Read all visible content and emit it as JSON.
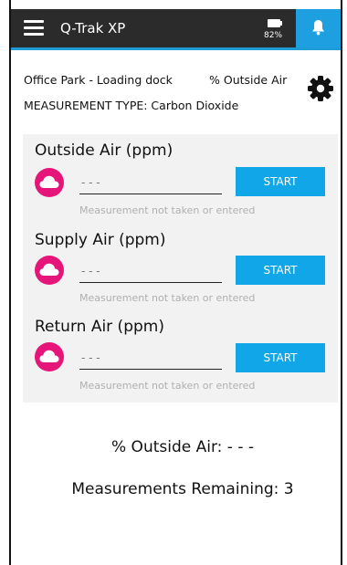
{
  "app": {
    "title": "Q-Trak XP",
    "battery": "82%"
  },
  "header": {
    "location": "Office Park - Loading dock",
    "calc_type": "% Outside Air",
    "measurement_type": "MEASUREMENT TYPE: Carbon Dioxide"
  },
  "sections": [
    {
      "title": "Outside Air (ppm)",
      "value": "",
      "placeholder": "- - -",
      "button": "START",
      "hint": "Measurement not taken or entered"
    },
    {
      "title": "Supply Air (ppm)",
      "value": "",
      "placeholder": "- - -",
      "button": "START",
      "hint": "Measurement not taken or entered"
    },
    {
      "title": "Return Air (ppm)",
      "value": "",
      "placeholder": "- - -",
      "button": "START",
      "hint": "Measurement not taken or entered"
    }
  ],
  "results": {
    "pct_outside_air": "% Outside Air: - - -",
    "remaining": "Measurements Remaining: 3"
  },
  "colors": {
    "topbar": "#2b2b2b",
    "accent": "#1e9fe0",
    "start_button": "#11a6e8",
    "cloud_button": "#e5157a",
    "card": "#f2f2f2"
  },
  "icons": {
    "menu": "hamburger-menu-icon",
    "battery": "battery-icon",
    "alert": "bell-icon",
    "settings": "gear-icon",
    "cloud": "cloud-icon"
  }
}
